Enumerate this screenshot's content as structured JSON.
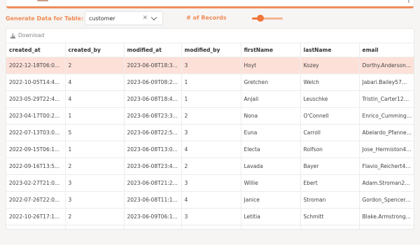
{
  "generate": {
    "label": "Generate Data for Table:",
    "selected_table": "customer",
    "records_label": "# of Records",
    "records_fraction": 0.22
  },
  "toolbar": {
    "download_label": "Download"
  },
  "table": {
    "columns": [
      "created_at",
      "created_by",
      "modified_at",
      "modified_by",
      "firstName",
      "lastName",
      "email"
    ],
    "rows": [
      [
        "2022-12-18T06:0...",
        "2",
        "2023-06-08T18:3...",
        "3",
        "Hoyt",
        "Kozey",
        "Dorthy.Anderson..."
      ],
      [
        "2022-10-05T14:4...",
        "4",
        "2023-06-09T08:2...",
        "1",
        "Gretchen",
        "Welch",
        "Jabari.Bailey57@h..."
      ],
      [
        "2023-05-29T22:4...",
        "4",
        "2023-06-08T18:4...",
        "1",
        "Anjali",
        "Leuschke",
        "Tristin_Carter12@..."
      ],
      [
        "2023-04-17T00:2...",
        "1",
        "2023-06-08T23:3...",
        "2",
        "Nona",
        "O'Connell",
        "Enrico_Cummings..."
      ],
      [
        "2022-07-13T03:0...",
        "5",
        "2023-06-08T22:5...",
        "3",
        "Euna",
        "Carroll",
        "Abelardo_Pfanner..."
      ],
      [
        "2022-09-15T06:1...",
        "1",
        "2023-06-08T13:0...",
        "4",
        "Electa",
        "Rolfson",
        "Jose_Hermiston47..."
      ],
      [
        "2022-09-16T13:5...",
        "2",
        "2023-06-08T23:4...",
        "2",
        "Lavada",
        "Bayer",
        "Flavio_Reichert40..."
      ],
      [
        "2023-02-27T21:0...",
        "3",
        "2023-06-08T21:2...",
        "3",
        "Willie",
        "Ebert",
        "Adam.Stroman28..."
      ],
      [
        "2022-07-26T22:0...",
        "3",
        "2023-06-08T11:1...",
        "4",
        "Janice",
        "Stroman",
        "Gordon_Spencer7..."
      ],
      [
        "2022-10-26T17:1...",
        "2",
        "2023-06-09T06:1...",
        "3",
        "Letitia",
        "Schmitt",
        "Blake.Armstrong..."
      ],
      [
        "",
        "",
        "",
        "",
        "",
        "",
        ""
      ]
    ]
  },
  "colors": {
    "accent": "#f08a55",
    "highlight_row": "#fde1d8"
  }
}
